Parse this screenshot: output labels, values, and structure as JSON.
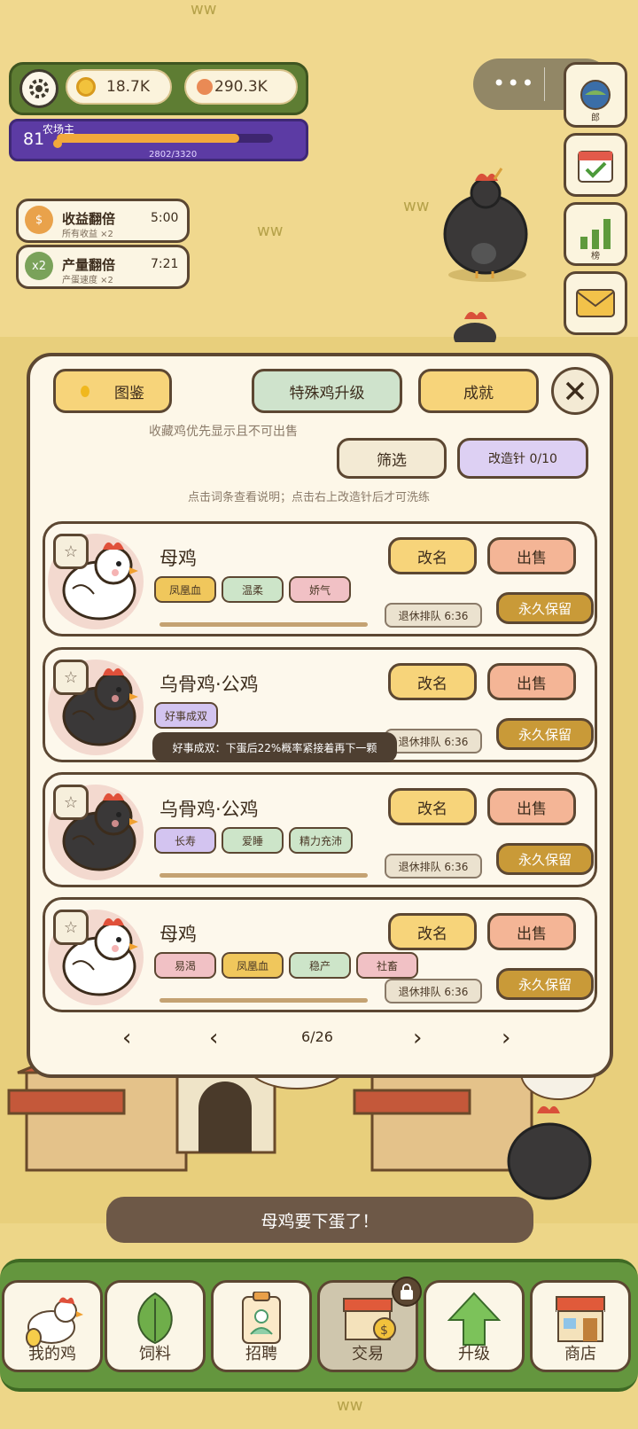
{
  "resources": {
    "coins": "18.7K",
    "gems": "290.3K",
    "level": "81",
    "level_title": "农场主",
    "xp_text": "2802/3320",
    "xp_fraction": 0.844
  },
  "buffs": [
    {
      "icon_text": "$",
      "title": "收益翻倍",
      "subtitle": "所有收益 ×2",
      "time": "5:00",
      "color": "#e9a24b"
    },
    {
      "icon_text": "x2",
      "title": "产量翻倍",
      "subtitle": "产蛋速度 ×2",
      "time": "7:21",
      "color": "#7aa25a"
    }
  ],
  "side_buttons": [
    {
      "name": "side-top",
      "label": "郎",
      "icon": "globe-icon"
    },
    {
      "name": "calendar",
      "label": "",
      "icon": "calendar-icon"
    },
    {
      "name": "ranking",
      "label": "榜",
      "icon": "bar-chart-icon"
    },
    {
      "name": "mail",
      "label": "",
      "icon": "mail-icon"
    }
  ],
  "panel": {
    "btn_collection": "图鉴",
    "btn_special_upgrade": "特殊鸡升级",
    "btn_achievement": "成就",
    "notice": "收藏鸡优先显示且不可出售",
    "btn_filter": "筛选",
    "btn_modify": "改造针 0/10",
    "hint": "点击词条查看说明；点击右上改造针后才可洗练"
  },
  "card_buttons": {
    "rename": "改名",
    "sell": "出售",
    "keep": "永久保留",
    "retire": "退休排队 6:36"
  },
  "chickens": [
    {
      "name": "母鸡",
      "type": "white",
      "tags": [
        {
          "label": "凤凰血",
          "style": "gold"
        },
        {
          "label": "温柔",
          "style": "mint"
        },
        {
          "label": "娇气",
          "style": "rose"
        }
      ],
      "progress": 0.72
    },
    {
      "name": "乌骨鸡·公鸡",
      "type": "black",
      "tags": [
        {
          "label": "好事成双",
          "style": "lav"
        }
      ],
      "progress": 0.0
    },
    {
      "name": "乌骨鸡·公鸡",
      "type": "black",
      "tags": [
        {
          "label": "长寿",
          "style": "lav"
        },
        {
          "label": "爱睡",
          "style": "mint"
        },
        {
          "label": "精力充沛",
          "style": "mint"
        }
      ],
      "progress": 0.72
    },
    {
      "name": "母鸡",
      "type": "white",
      "tags": [
        {
          "label": "易渴",
          "style": "rose"
        },
        {
          "label": "凤凰血",
          "style": "gold"
        },
        {
          "label": "稳产",
          "style": "mint"
        },
        {
          "label": "社畜",
          "style": "rose"
        }
      ],
      "progress": 0.72
    }
  ],
  "tooltip": "好事成双：下蛋后22%概率紧接着再下一颗",
  "pagination": {
    "page": "6/26"
  },
  "toast": "母鸡要下蛋了！",
  "nav": [
    {
      "label": "我的鸡",
      "icon": "chicken-icon"
    },
    {
      "label": "饲料",
      "icon": "leaf-icon"
    },
    {
      "label": "招聘",
      "icon": "badge-icon"
    },
    {
      "label": "交易",
      "icon": "market-icon",
      "locked": true
    },
    {
      "label": "升级",
      "icon": "arrow-up-icon"
    },
    {
      "label": "商店",
      "icon": "shop-icon"
    }
  ]
}
